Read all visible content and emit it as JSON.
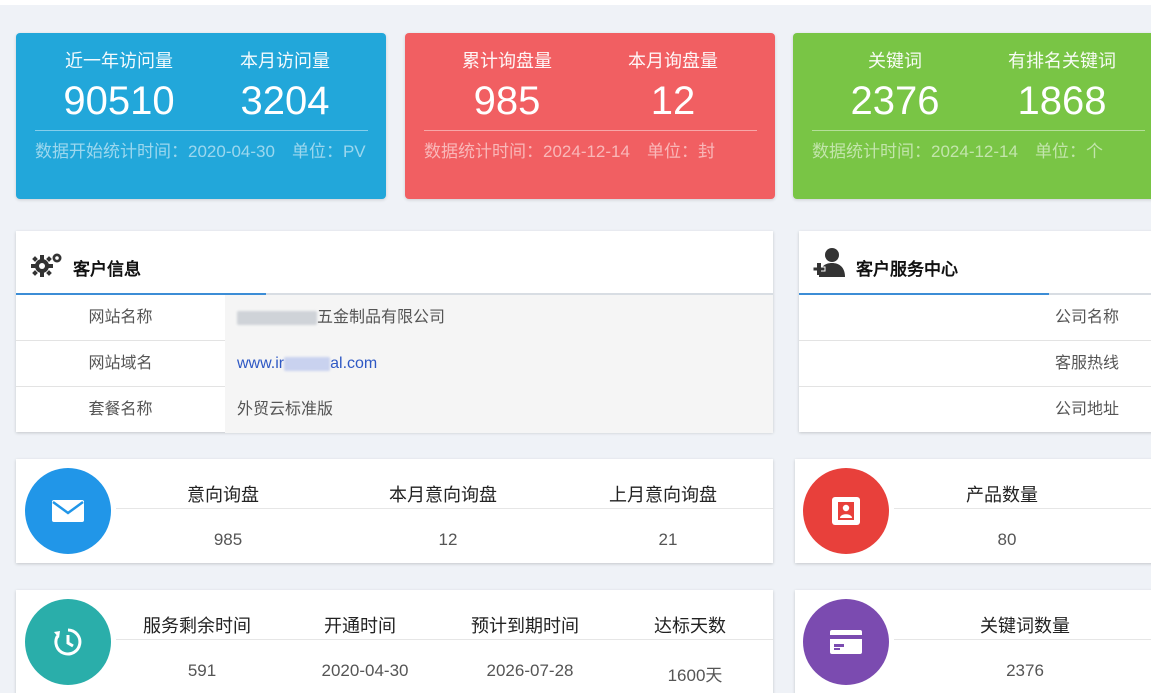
{
  "stats": {
    "blue": {
      "label1": "近一年访问量",
      "value1": "90510",
      "label2": "本月访问量",
      "value2": "3204",
      "footer": "数据开始统计时间：2020-04-30　单位：PV"
    },
    "red": {
      "label1": "累计询盘量",
      "value1": "985",
      "label2": "本月询盘量",
      "value2": "12",
      "footer": "数据统计时间：2024-12-14　单位：封"
    },
    "green": {
      "label1": "关键词",
      "value1": "2376",
      "label2": "有排名关键词",
      "value2": "1868",
      "footer": "数据统计时间：2024-12-14　单位：个"
    }
  },
  "customer_info": {
    "title": "客户信息",
    "rows": [
      {
        "key": "网站名称",
        "value_suffix": "五金制品有限公司"
      },
      {
        "key": "网站域名",
        "value_prefix": "www.ir",
        "value_suffix": "al.com"
      },
      {
        "key": "套餐名称",
        "value": "外贸云标准版"
      }
    ]
  },
  "service_center": {
    "title": "客户服务中心",
    "rows": [
      "公司名称",
      "客服热线",
      "公司地址"
    ]
  },
  "inquiry_card": {
    "headers": [
      "意向询盘",
      "本月意向询盘",
      "上月意向询盘"
    ],
    "values": [
      "985",
      "12",
      "21"
    ]
  },
  "product_card": {
    "header": "产品数量",
    "value": "80"
  },
  "service_card": {
    "headers": [
      "服务剩余时间",
      "开通时间",
      "预计到期时间",
      "达标天数"
    ],
    "values": [
      "591",
      "2020-04-30",
      "2026-07-28",
      "1600天"
    ]
  },
  "keyword_card": {
    "header": "关键词数量",
    "value": "2376"
  },
  "colors": {
    "blue": "#22a7da",
    "red": "#f15f62",
    "green": "#79c545",
    "mail": "#2196e8",
    "teal": "#2aaeaa",
    "product": "#e8403b",
    "purple": "#7b4bb0"
  },
  "icons": [
    "gears-icon",
    "add-user-icon",
    "mail-icon",
    "contact-card-icon",
    "history-icon",
    "credit-card-icon"
  ]
}
